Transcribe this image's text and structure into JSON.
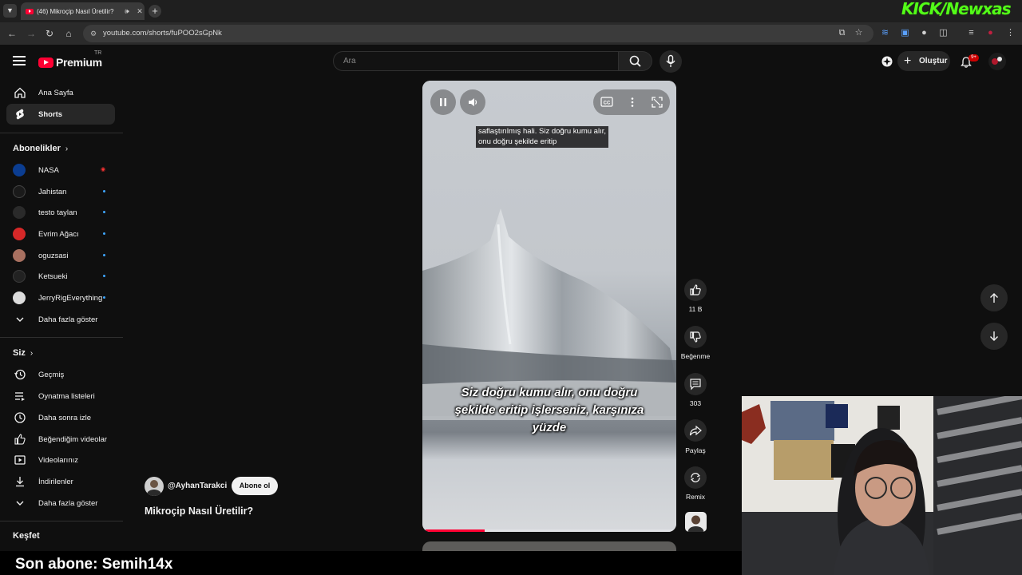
{
  "browser": {
    "tab_title": "(46) Mikroçip Nasıl Üretilir?",
    "url": "youtube.com/shorts/fuPOO2sGpNk",
    "kick_logo": "KICK/Newxas"
  },
  "header": {
    "logo_text": "Premium",
    "logo_region": "TR",
    "search_placeholder": "Ara",
    "create_label": "Oluştur",
    "notification_count": "9+"
  },
  "sidebar": {
    "main": [
      {
        "label": "Ana Sayfa",
        "icon": "home-icon"
      },
      {
        "label": "Shorts",
        "icon": "shorts-icon"
      }
    ],
    "subscriptions_heading": "Abonelikler",
    "subscriptions": [
      {
        "label": "NASA",
        "indicator": "live"
      },
      {
        "label": "Jahistan",
        "indicator": "new"
      },
      {
        "label": "testo taylan",
        "indicator": "new"
      },
      {
        "label": "Evrim Ağacı",
        "indicator": "new"
      },
      {
        "label": "oguzsasi",
        "indicator": "new"
      },
      {
        "label": "Ketsueki",
        "indicator": "new"
      },
      {
        "label": "JerryRigEverything",
        "indicator": "new"
      }
    ],
    "show_more_1": "Daha fazla göster",
    "you_heading": "Siz",
    "you_items": [
      {
        "label": "Geçmiş",
        "icon": "history-icon"
      },
      {
        "label": "Oynatma listeleri",
        "icon": "playlist-icon"
      },
      {
        "label": "Daha sonra izle",
        "icon": "clock-icon"
      },
      {
        "label": "Beğendiğim videolar",
        "icon": "like-icon"
      },
      {
        "label": "Videolarınız",
        "icon": "video-icon"
      },
      {
        "label": "İndirilenler",
        "icon": "download-icon"
      }
    ],
    "show_more_2": "Daha fazla göster",
    "explore_heading": "Keşfet"
  },
  "player": {
    "caption_top": "saflaştırılmış hali. Siz doğru kumu alır, onu doğru şekilde eritip",
    "caption_big": "Siz doğru kumu alır, onu doğru şekilde eritip işlerseniz, karşınıza yüzde",
    "progress": 0.24
  },
  "actions": {
    "likes": "11 B",
    "dislike_label": "Beğenme",
    "comments": "303",
    "share_label": "Paylaş",
    "remix_label": "Remix"
  },
  "video": {
    "channel_handle": "@AyhanTarakci",
    "subscribe_label": "Abone ol",
    "title": "Mikroçip Nasıl Üretilir?"
  },
  "overlay": {
    "last_subscriber": "Son abone: Semih14x"
  },
  "colors": {
    "accent_red": "#ff0033",
    "kick_green": "#53fc18",
    "bg": "#0f0f0f"
  }
}
